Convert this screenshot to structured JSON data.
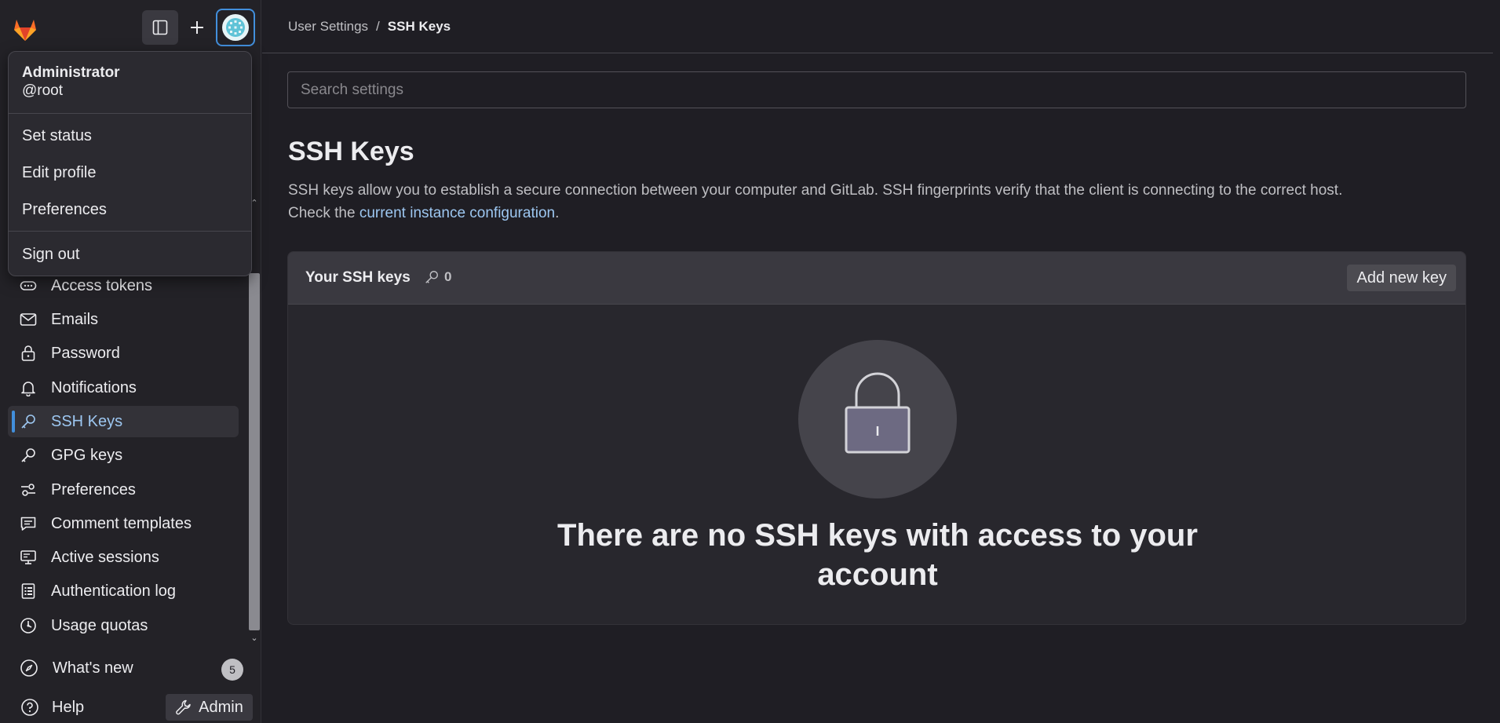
{
  "sidebar": {
    "nav_items": [
      {
        "label": "Access tokens",
        "icon": "token-icon"
      },
      {
        "label": "Emails",
        "icon": "mail-icon"
      },
      {
        "label": "Password",
        "icon": "lock-icon"
      },
      {
        "label": "Notifications",
        "icon": "bell-icon"
      },
      {
        "label": "SSH Keys",
        "icon": "key-icon",
        "active": true
      },
      {
        "label": "GPG keys",
        "icon": "key-icon"
      },
      {
        "label": "Preferences",
        "icon": "preferences-icon"
      },
      {
        "label": "Comment templates",
        "icon": "comment-icon"
      },
      {
        "label": "Active sessions",
        "icon": "monitor-icon"
      },
      {
        "label": "Authentication log",
        "icon": "log-icon"
      },
      {
        "label": "Usage quotas",
        "icon": "quota-icon"
      }
    ],
    "whats_new": {
      "label": "What's new",
      "badge": "5"
    },
    "help": {
      "label": "Help"
    },
    "admin": {
      "label": "Admin"
    }
  },
  "user_menu": {
    "name": "Administrator",
    "username": "@root",
    "items": [
      "Set status",
      "Edit profile",
      "Preferences"
    ],
    "sign_out": "Sign out"
  },
  "breadcrumb": {
    "parent": "User Settings",
    "separator": "/",
    "current": "SSH Keys"
  },
  "search": {
    "placeholder": "Search settings"
  },
  "page": {
    "title": "SSH Keys",
    "description_1": "SSH keys allow you to establish a secure connection between your computer and GitLab. SSH fingerprints verify that the client is connecting to the correct host.",
    "description_2_prefix": "Check the ",
    "description_link": "current instance configuration",
    "description_2_suffix": "."
  },
  "card": {
    "title": "Your SSH keys",
    "count": "0",
    "add_button": "Add new key",
    "empty_message": "There are no SSH keys with access to your account"
  },
  "colors": {
    "accent": "#428fdc",
    "link": "#9dc7f1",
    "logo_orange": "#e24329"
  }
}
